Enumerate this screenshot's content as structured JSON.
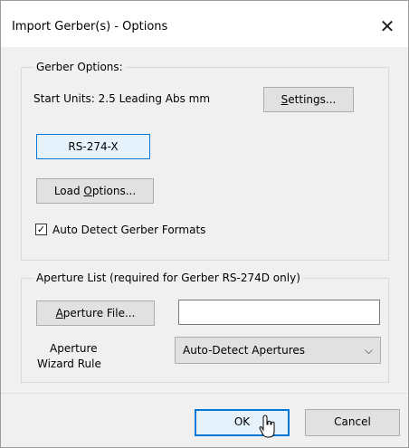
{
  "window": {
    "title": "Import Gerber(s) - Options",
    "close_glyph": "✕"
  },
  "gerber_options": {
    "legend": "Gerber Options:",
    "start_units": "Start Units: 2.5 Leading Abs mm",
    "settings_button": {
      "mnemonic": "S",
      "rest": "ettings..."
    },
    "format_button": "RS-274-X",
    "load_options_button": {
      "pre": "Load ",
      "mnemonic": "O",
      "rest": "ptions..."
    },
    "auto_detect_checkbox": {
      "label": "Auto Detect Gerber Formats",
      "checked": true,
      "check_glyph": "✓"
    }
  },
  "aperture_list": {
    "legend": "Aperture List (required for Gerber RS-274D only)",
    "aperture_file_button": {
      "mnemonic": "A",
      "rest": "perture File..."
    },
    "aperture_file_value": "",
    "wizard_rule_label_line1": "Aperture",
    "wizard_rule_label_line2": "Wizard Rule",
    "wizard_rule_selected": "Auto-Detect Apertures",
    "chevron_glyph": "⌵"
  },
  "footer": {
    "ok_label": "OK",
    "cancel_label": "Cancel"
  },
  "colors": {
    "accent": "#0078d7",
    "dialog_bg": "#f0f0f0",
    "button_bg": "#e1e1e1"
  }
}
